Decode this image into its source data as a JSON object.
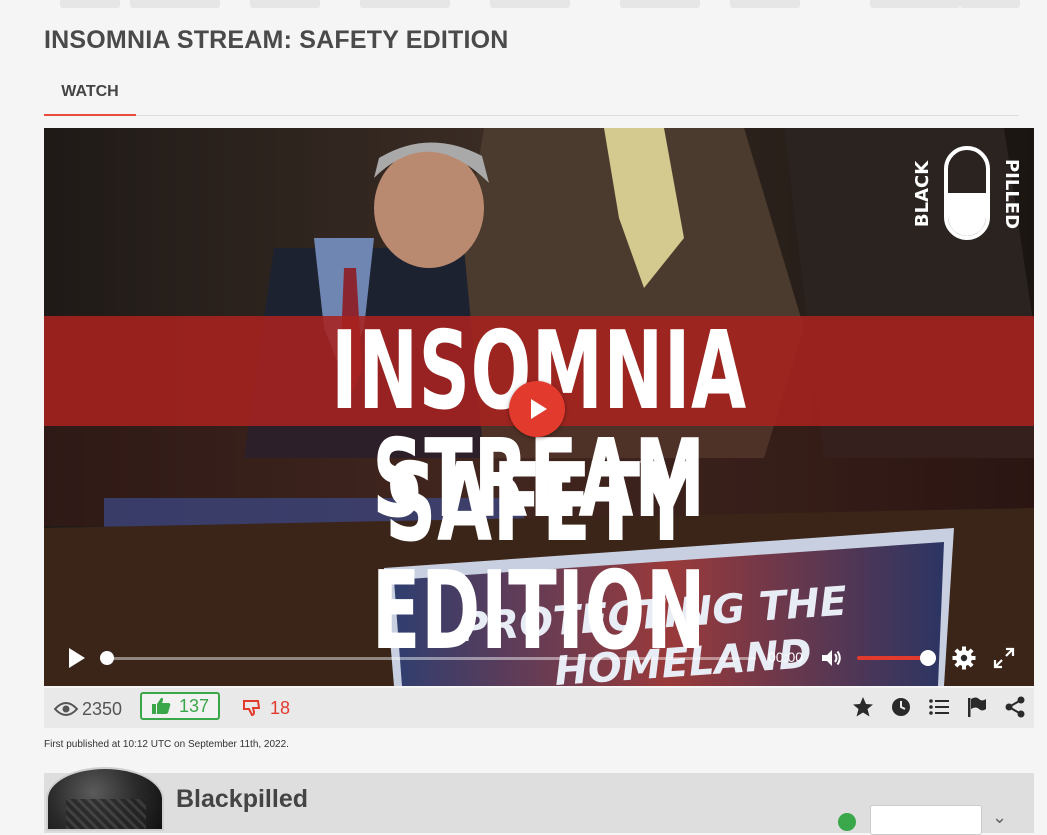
{
  "page": {
    "title": "INSOMNIA STREAM: SAFETY EDITION"
  },
  "tabs": [
    {
      "label": "WATCH",
      "active": true
    }
  ],
  "player": {
    "poster_line1": "INSOMNIA STREAM",
    "poster_line2": "SAFETY EDITION",
    "poster_sign": "PROTECTING THE HOMELAND",
    "logo_text": "BLACK PILLED",
    "time": "00:00",
    "progress": 0,
    "volume": 1,
    "accent_color": "#e23b2e"
  },
  "stats": {
    "views": "2350",
    "likes": "137",
    "dislikes": "18",
    "icons": [
      "eye-icon",
      "thumbs-up-icon",
      "thumbs-down-icon",
      "star-icon",
      "clock-icon",
      "playlist-icon",
      "flag-icon",
      "share-icon"
    ]
  },
  "published": "First published at 10:12 UTC on September 11th, 2022.",
  "channel": {
    "name": "Blackpilled"
  }
}
